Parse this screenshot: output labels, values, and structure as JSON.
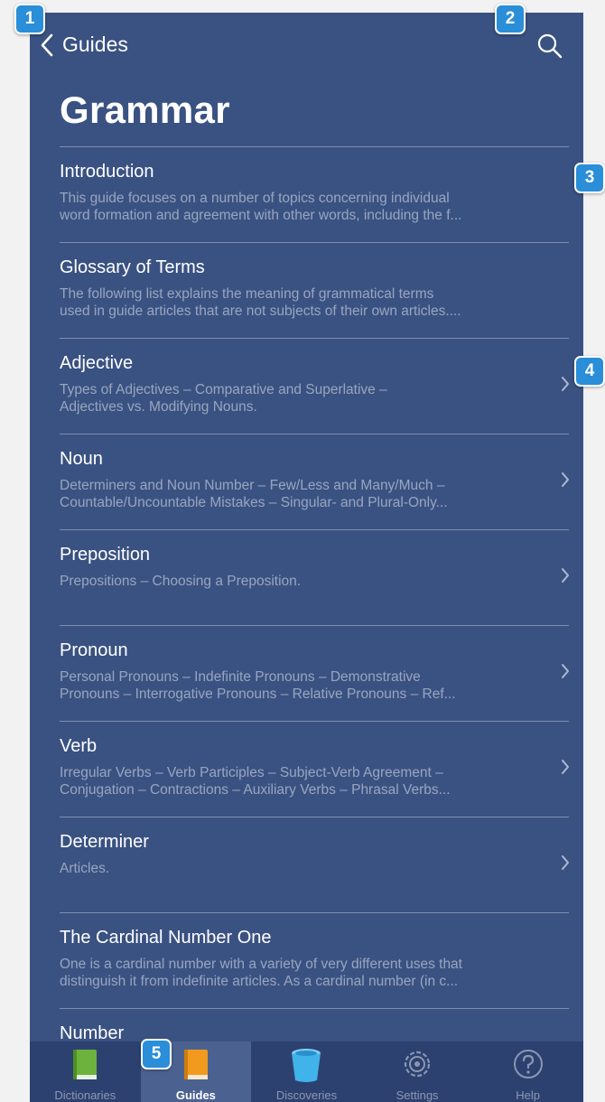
{
  "nav": {
    "back_label": "Guides",
    "search_icon": "search-icon"
  },
  "page_title": "Grammar",
  "items": [
    {
      "title": "Introduction",
      "desc1": "This guide focuses on a number of topics concerning individual",
      "desc2": "word formation and agreement with other words, including the f...",
      "chevron": false
    },
    {
      "title": "Glossary of Terms",
      "desc1": "The following list explains the meaning of grammatical terms",
      "desc2": "used in guide articles that are not subjects of their own articles....",
      "chevron": false
    },
    {
      "title": "Adjective",
      "desc1": "Types of Adjectives – Comparative and Superlative –",
      "desc2": "Adjectives vs. Modifying Nouns.",
      "chevron": true
    },
    {
      "title": "Noun",
      "desc1": "Determiners and Noun Number – Few/Less and Many/Much –",
      "desc2": "Countable/Uncountable Mistakes – Singular- and Plural-Only...",
      "chevron": true
    },
    {
      "title": "Preposition",
      "desc1": "Prepositions – Choosing a Preposition.",
      "desc2": "",
      "chevron": true
    },
    {
      "title": "Pronoun",
      "desc1": "Personal Pronouns – Indefinite Pronouns – Demonstrative",
      "desc2": "Pronouns – Interrogative Pronouns – Relative Pronouns – Ref...",
      "chevron": true
    },
    {
      "title": "Verb",
      "desc1": "Irregular Verbs – Verb Participles – Subject-Verb Agreement –",
      "desc2": "Conjugation – Contractions – Auxiliary Verbs – Phrasal Verbs...",
      "chevron": true
    },
    {
      "title": "Determiner",
      "desc1": "Articles.",
      "desc2": "",
      "chevron": true
    },
    {
      "title": "The Cardinal Number One",
      "desc1": "One is a cardinal number with a variety of very different uses that",
      "desc2": "distinguish it from indefinite articles. As a cardinal number (in c...",
      "chevron": false
    },
    {
      "title": "Number",
      "desc1": "",
      "desc2": "",
      "chevron": false
    }
  ],
  "tabs": [
    {
      "label": "Dictionaries",
      "icon": "green-book-icon",
      "active": false
    },
    {
      "label": "Guides",
      "icon": "orange-book-icon",
      "active": true
    },
    {
      "label": "Discoveries",
      "icon": "blue-cup-icon",
      "active": false
    },
    {
      "label": "Settings",
      "icon": "gear-icon",
      "active": false
    },
    {
      "label": "Help",
      "icon": "question-icon",
      "active": false
    }
  ],
  "badges": [
    "1",
    "2",
    "3",
    "4",
    "5"
  ],
  "colors": {
    "background": "#3a5282",
    "tabbar": "#2c4170",
    "active_tab": "#4b6291",
    "badge": "#2a8ed8"
  }
}
